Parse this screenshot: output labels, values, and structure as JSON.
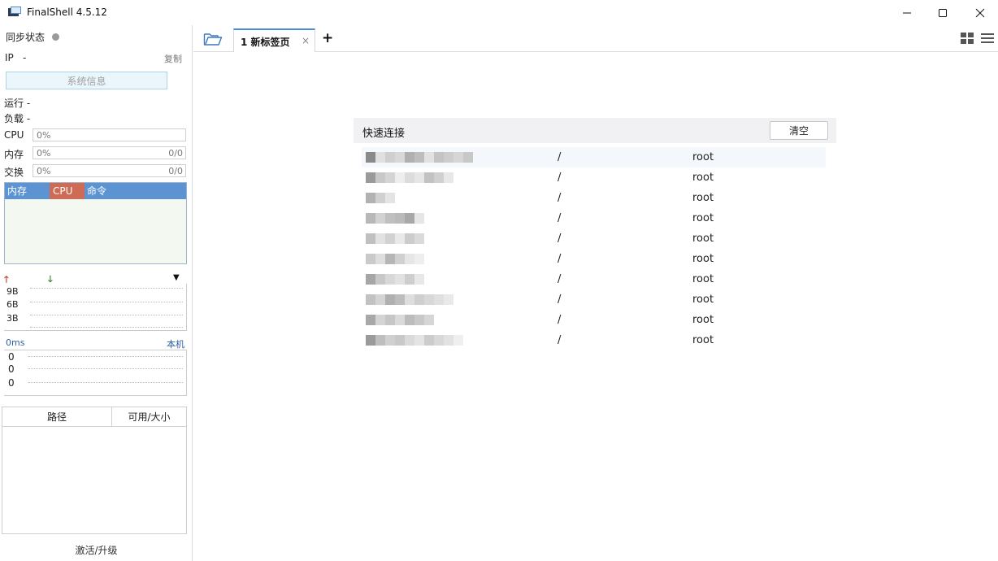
{
  "window": {
    "title": "FinalShell 4.5.12",
    "controls": {
      "minimize": "minimize",
      "maximize": "maximize",
      "close": "close"
    }
  },
  "sidebar": {
    "sync_label": "同步状态",
    "ip_label": "IP",
    "ip_value": "-",
    "copy_label": "复制",
    "sysinfo_label": "系统信息",
    "run_label": "运行 -",
    "load_label": "负载 -",
    "meters": [
      {
        "label": "CPU",
        "value": "0%",
        "ratio": ""
      },
      {
        "label": "内存",
        "value": "0%",
        "ratio": "0/0"
      },
      {
        "label": "交换",
        "value": "0%",
        "ratio": "0/0"
      }
    ],
    "process_columns": {
      "mem": "内存",
      "cpu": "CPU",
      "cmd": "命令"
    },
    "net": {
      "ticks": [
        "9B",
        "6B",
        "3B"
      ]
    },
    "ping": {
      "latency": "0ms",
      "target": "本机",
      "ticks": [
        "0",
        "0",
        "0"
      ]
    },
    "disk_columns": {
      "path": "路径",
      "avail": "可用/大小"
    },
    "activate_label": "激活/升级"
  },
  "tabs": {
    "items": [
      {
        "label": "1 新标签页",
        "close": "×"
      }
    ],
    "add_label": "+"
  },
  "quick_connect": {
    "title": "快速连接",
    "clear_label": "清空",
    "rows": [
      {
        "path": "/",
        "user": "root"
      },
      {
        "path": "/",
        "user": "root"
      },
      {
        "path": "/",
        "user": "root"
      },
      {
        "path": "/",
        "user": "root"
      },
      {
        "path": "/",
        "user": "root"
      },
      {
        "path": "/",
        "user": "root"
      },
      {
        "path": "/",
        "user": "root"
      },
      {
        "path": "/",
        "user": "root"
      },
      {
        "path": "/",
        "user": "root"
      },
      {
        "path": "/",
        "user": "root"
      }
    ]
  },
  "colors": {
    "tab_accent": "#4a8ad1",
    "process_header": "#5b93d3",
    "cpu_header": "#cf6a55",
    "link": "#2d5fa3"
  }
}
